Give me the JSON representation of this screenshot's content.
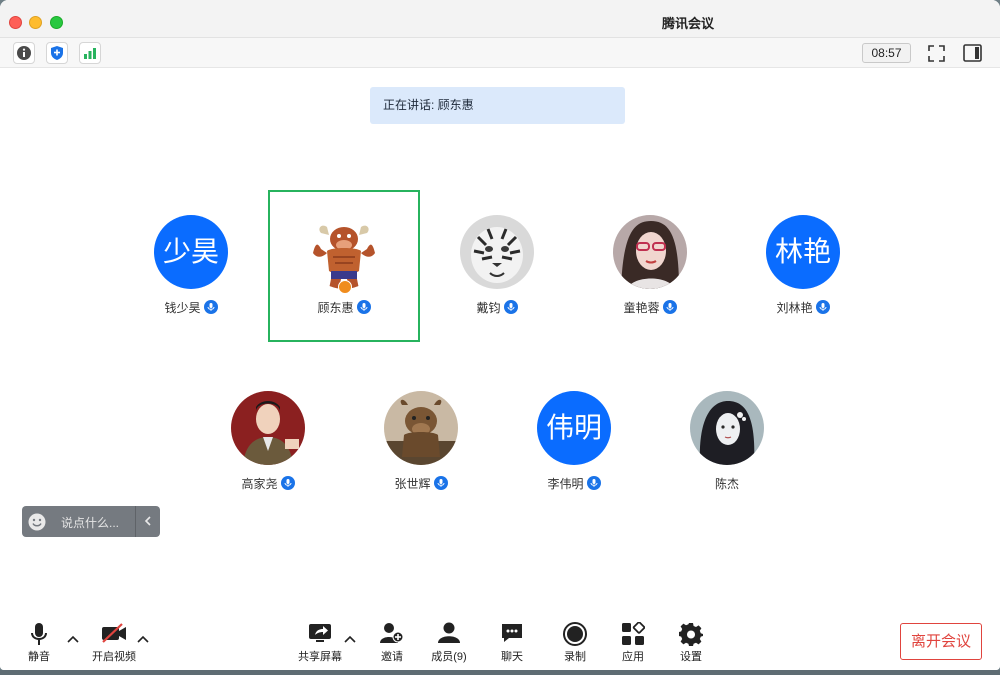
{
  "window": {
    "title": "腾讯会议"
  },
  "toolbar": {
    "info_icon": "info-icon",
    "security_icon": "shield-icon",
    "signal_icon": "signal-icon",
    "timer": "08:57",
    "fullscreen_icon": "fullscreen-icon",
    "sidebar_icon": "sidebar-icon"
  },
  "speaking": {
    "label": "正在讲话: 顾东惠"
  },
  "participants": [
    {
      "name": "钱少昊",
      "avatar_text": "少昊",
      "mic": "on"
    },
    {
      "name": "顾东惠",
      "avatar_text": "",
      "mic": "on",
      "host": true,
      "active": true
    },
    {
      "name": "戴钧",
      "avatar_text": "",
      "mic": "on"
    },
    {
      "name": "童艳蓉",
      "avatar_text": "",
      "mic": "on"
    },
    {
      "name": "刘林艳",
      "avatar_text": "林艳",
      "mic": "on"
    },
    {
      "name": "高家尧",
      "avatar_text": "",
      "mic": "on"
    },
    {
      "name": "张世辉",
      "avatar_text": "",
      "mic": "on"
    },
    {
      "name": "李伟明",
      "avatar_text": "伟明",
      "mic": "on"
    },
    {
      "name": "陈杰",
      "avatar_text": "",
      "mic": "none"
    }
  ],
  "chat": {
    "placeholder": "说点什么..."
  },
  "controls": {
    "mute": "静音",
    "video": "开启视频",
    "share": "共享屏幕",
    "invite": "邀请",
    "members": "成员(9)",
    "chat": "聊天",
    "record": "录制",
    "apps": "应用",
    "settings": "设置",
    "leave": "离开会议"
  },
  "colors": {
    "accent": "#0a6cff",
    "active_border": "#27b35e",
    "leave": "#e0443e",
    "speaking_bg": "#dbe9fb"
  }
}
